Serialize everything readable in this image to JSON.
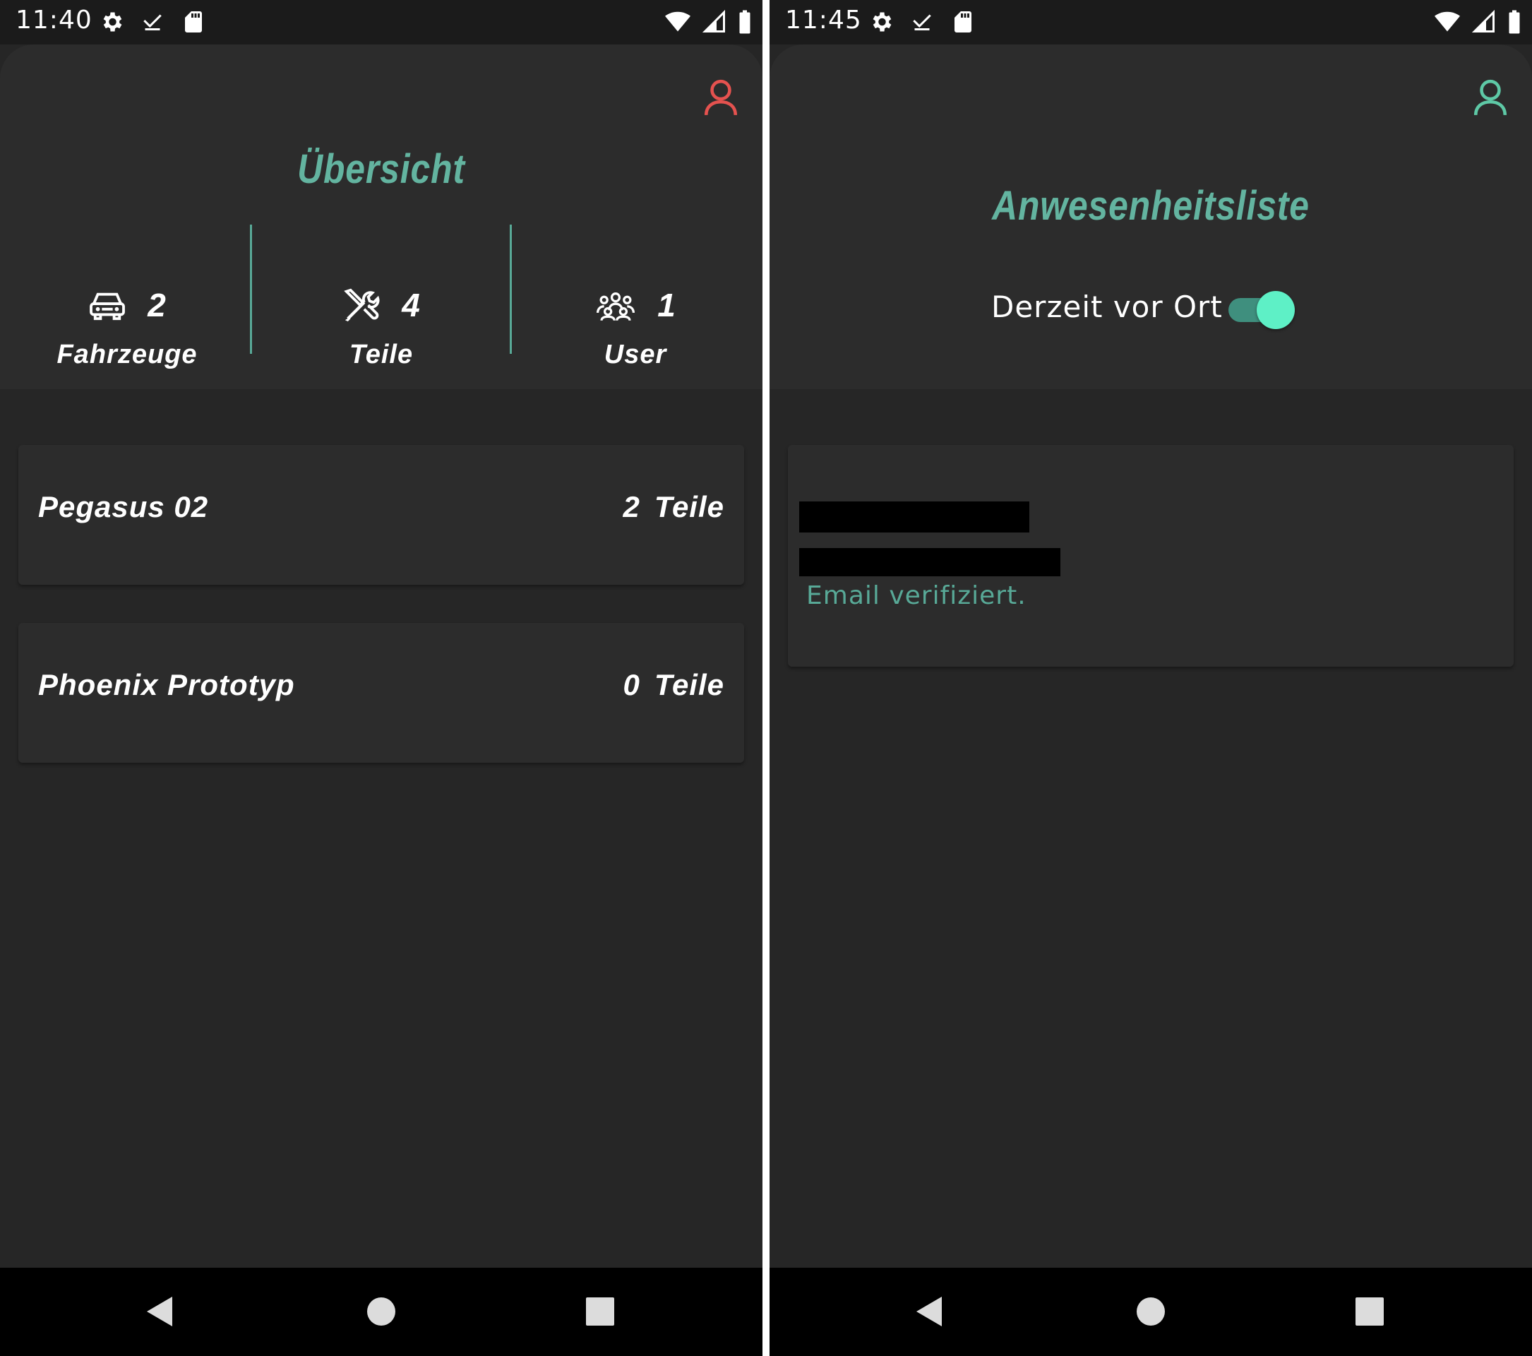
{
  "colors": {
    "accent": "#63b4a0",
    "background": "#262626",
    "header": "#2c2c2c",
    "profile_icon_left": "#e5524f",
    "profile_icon_right": "#5ec9a6",
    "toggle_thumb": "#5ef0c6"
  },
  "left_screen": {
    "status_time": "11:40",
    "title": "Übersicht",
    "stats": [
      {
        "icon": "car-icon",
        "value": "2",
        "label": "Fahrzeuge"
      },
      {
        "icon": "tools-icon",
        "value": "4",
        "label": "Teile"
      },
      {
        "icon": "users-icon",
        "value": "1",
        "label": "User"
      }
    ],
    "vehicles": [
      {
        "name": "Pegasus 02",
        "count": "2",
        "unit": "Teile"
      },
      {
        "name": "Phoenix Prototyp",
        "count": "0",
        "unit": "Teile"
      }
    ]
  },
  "right_screen": {
    "status_time": "11:45",
    "title": "Anwesenheitsliste",
    "toggle_label": "Derzeit vor Ort",
    "toggle_on": true,
    "user_status": "Email verifiziert."
  },
  "status_icons_left": [
    "settings-icon",
    "download-done-icon",
    "sd-card-icon"
  ],
  "status_icons_right": [
    "wifi-icon",
    "signal-icon",
    "battery-icon"
  ],
  "nav_buttons": [
    "back-icon",
    "home-icon",
    "recents-icon"
  ]
}
